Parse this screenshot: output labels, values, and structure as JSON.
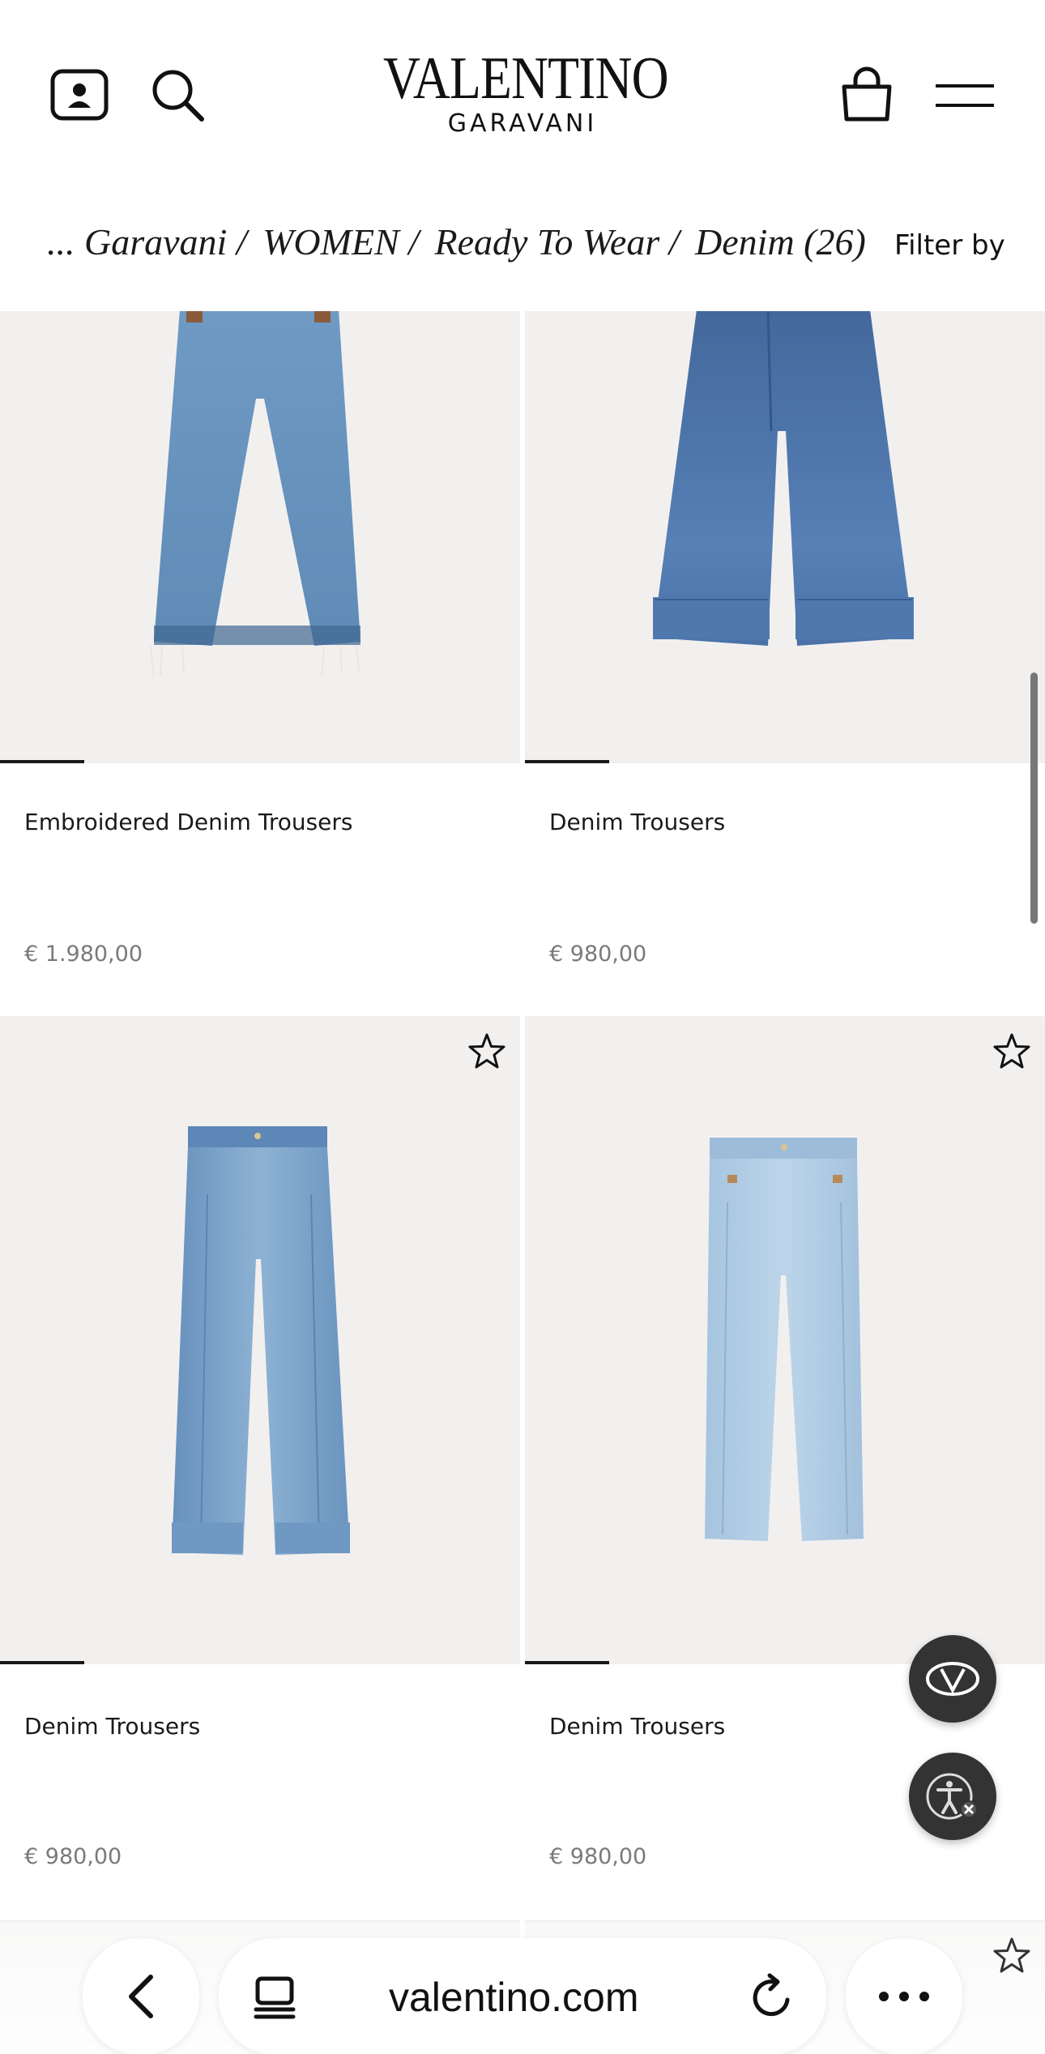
{
  "header": {
    "logo_main": "VALENTINO",
    "logo_sub": "GARAVANI"
  },
  "breadcrumb": {
    "items": [
      "... Garavani /",
      "WOMEN /",
      "Ready To Wear /",
      "Denim (26)"
    ],
    "filter_label": "Filter by"
  },
  "products": [
    {
      "name": "Embroidered Denim Trousers",
      "price": "€ 1.980,00",
      "wash": "#6e98c2"
    },
    {
      "name": "Denim Trousers",
      "price": "€ 980,00",
      "wash": "#45699e"
    },
    {
      "name": "Denim Trousers",
      "price": "€ 980,00",
      "wash": "#76a2c8"
    },
    {
      "name": "Denim Trousers",
      "price": "€ 980,00",
      "wash": "#aecbe3"
    }
  ],
  "browser": {
    "url": "valentino.com"
  },
  "colors": {
    "text": "#1a1a1a",
    "price": "#7a7a7a",
    "image_bg": "#f2f0ef",
    "fab": "#333333"
  },
  "icons": [
    "account-icon",
    "search-icon",
    "bag-icon",
    "menu-icon",
    "star-icon",
    "valentino-v-icon",
    "accessibility-icon",
    "back-icon",
    "tabs-icon",
    "reload-icon",
    "more-icon"
  ]
}
